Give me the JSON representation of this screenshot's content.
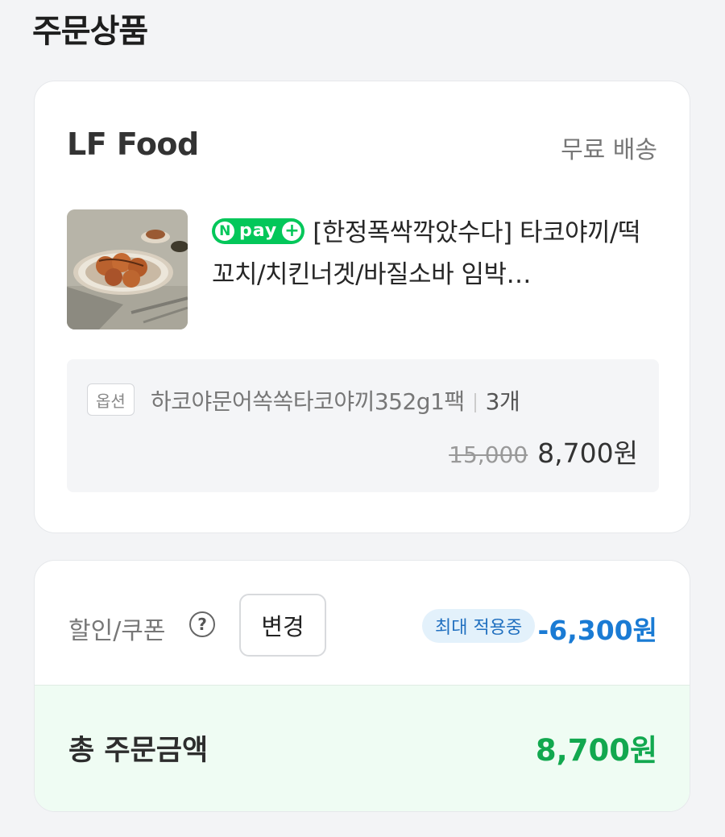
{
  "section_title": "주문상품",
  "store": {
    "name": "LF Food",
    "shipping": "무료 배송"
  },
  "product": {
    "npay_n": "N",
    "npay_text": "pay",
    "npay_plus": "+",
    "title": "[한정폭싹깍았수다] 타코야끼/떡꼬치/치킨너겟/바질소바 임박…",
    "image": "takoyaki-plate"
  },
  "option": {
    "badge": "옵션",
    "name": "하코야문어쏙쏙타코야끼352g1팩",
    "qty": "3개",
    "original_price": "15,000",
    "sale_price": "8,700원"
  },
  "payment": {
    "discount_label": "할인/쿠폰",
    "help_icon": "?",
    "change_button": "변경",
    "max_badge": "최대 적용중",
    "discount_amount": "-6,300원",
    "total_label": "총 주문금액",
    "total_amount": "8,700원"
  },
  "colors": {
    "npay_green": "#03c75a",
    "discount_blue": "#1a7bd4",
    "total_green": "#12a84f",
    "total_bg": "#effcf3"
  }
}
